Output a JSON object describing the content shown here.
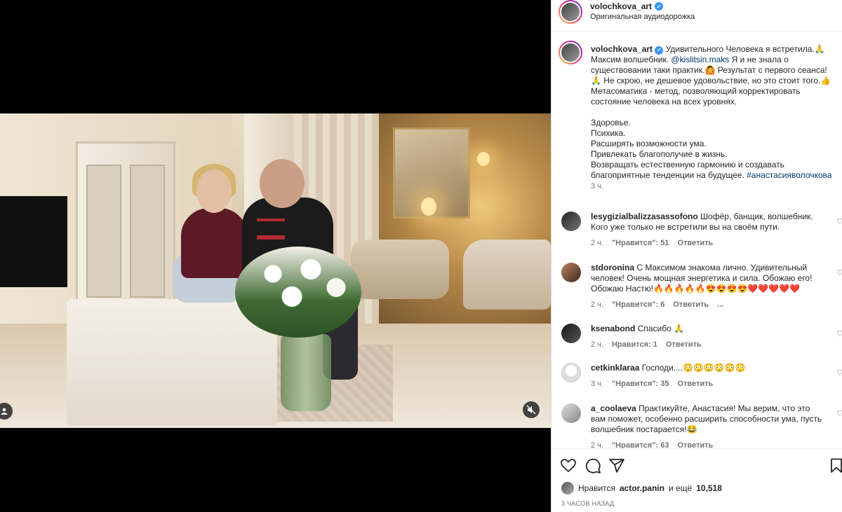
{
  "post": {
    "author": "volochkova_art",
    "audio_label": "Оригинальная аудиодорожка",
    "caption_lines": [
      "Удивительного Человека я встретила.🙏",
      "Максим волшебник. ",
      "Я и не знала о",
      "существовании таки практик.🙆 Результат с первого сеанса!",
      "🙏 Не скрою, не дешевое удовольствие, но это стоит того.👍",
      "Метасоматика - метод, позволяющий корректировать",
      "состояние человека на всех уровнях.",
      "",
      "Здоровье.",
      "Психика.",
      "Расширять возможности ума.",
      "Привлекать благополучие в жизнь.",
      "Возвращать естественную гармонию и создавать",
      "благоприятные тенденции на будущее. "
    ],
    "mention": "@kislitsin.maks",
    "hashtag": "#анастасияволочкова",
    "caption_time": "3 ч."
  },
  "comments": [
    {
      "user": "lesygizialbalizzasassofono",
      "text": "Шофёр, банщик, волшебник. Кого уже только не встретили вы на своём пути.",
      "time": "2 ч.",
      "likes": "\"Нравится\": 51",
      "reply": "Ответить"
    },
    {
      "user": "stdoronina",
      "text": "С Максимом знакома лично. Удивительный человек! Очень мощная энергетика и сила. Обожаю его! Обожаю Настю!🔥🔥🔥🔥🔥😍😍😍😍❤️❤️❤️❤️❤️",
      "time": "2 ч.",
      "likes": "\"Нравится\": 6",
      "reply": "Ответить",
      "more": "..."
    },
    {
      "user": "ksenabond",
      "text": "Спасибо 🙏",
      "time": "2 ч.",
      "likes": "Нравится: 1",
      "reply": "Ответить"
    },
    {
      "user": "cetkinklaraa",
      "text": "Господи....😳😳😳😳😳😳",
      "time": "3 ч.",
      "likes": "\"Нравится\": 35",
      "reply": "Ответить"
    },
    {
      "user": "a_coolaeva",
      "text": "Практикуйте, Анастасия! Мы верим, что это вам поможет, особенно расширить способности ума, пусть волшебник постарается!😂",
      "time": "2 ч.",
      "likes": "\"Нравится\": 63",
      "reply": "Ответить"
    }
  ],
  "likes_summary": {
    "prefix": "Нравится",
    "user": "actor.panin",
    "suffix": "и ещё",
    "count": "10,518"
  },
  "post_time": "3 ЧАСОВ НАЗАД",
  "icons": {
    "verified": "verified-badge-icon",
    "like": "heart-icon",
    "comment": "comment-icon",
    "share": "share-icon",
    "save": "bookmark-icon",
    "mute": "speaker-muted-icon",
    "tag": "user-tag-icon"
  },
  "colors": {
    "link": "#00376b",
    "verified": "#3897f0",
    "muted_text": "#737373"
  }
}
